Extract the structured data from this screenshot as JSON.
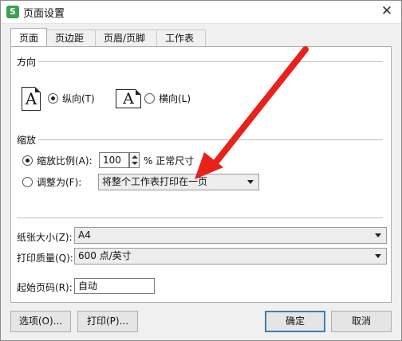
{
  "window": {
    "title": "页面设置",
    "app_icon_text": "S",
    "close_glyph": "✕"
  },
  "tabs": [
    {
      "label": "页面",
      "active": true
    },
    {
      "label": "页边距",
      "active": false
    },
    {
      "label": "页眉/页脚",
      "active": false
    },
    {
      "label": "工作表",
      "active": false
    }
  ],
  "orientation": {
    "section_label": "方向",
    "portrait_icon_letter": "A",
    "portrait_label": "纵向(T)",
    "portrait_selected": true,
    "landscape_icon_letter": "A",
    "landscape_label": "横向(L)",
    "landscape_selected": false
  },
  "scaling": {
    "section_label": "缩放",
    "adjust_label": "缩放比例(A):",
    "adjust_selected": true,
    "percent_value": "100",
    "percent_suffix": "% 正常尺寸",
    "fit_label": "调整为(F):",
    "fit_selected": false,
    "fit_option": "将整个工作表打印在一页"
  },
  "paper": {
    "size_label": "纸张大小(Z):",
    "size_value": "A4",
    "quality_label": "打印质量(Q):",
    "quality_value": "600 点/英寸",
    "first_page_label": "起始页码(R):",
    "first_page_value": "自动"
  },
  "buttons": {
    "options_label": "选项(O)...",
    "print_label": "打印(P)...",
    "ok_label": "确定",
    "cancel_label": "取消"
  },
  "colors": {
    "annotation_arrow": "#e8211b",
    "app_icon": "#39a24a",
    "default_button_border": "#3c7fb1"
  }
}
